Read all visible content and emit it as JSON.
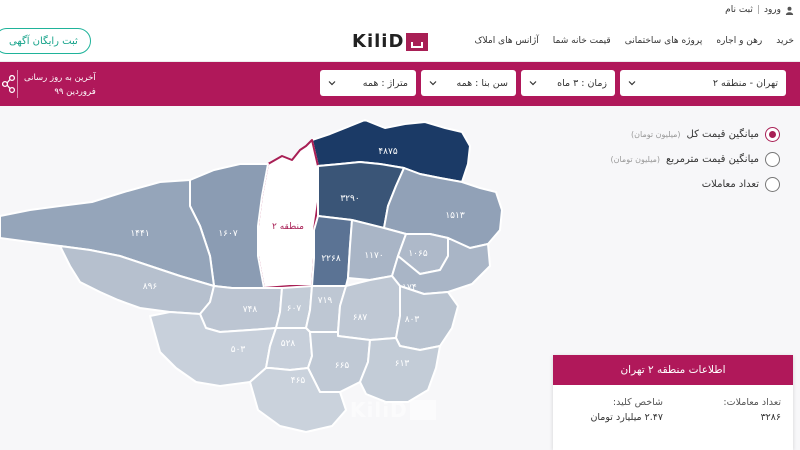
{
  "auth": {
    "login": "ورود",
    "separator": "|",
    "register": "ثبت نام"
  },
  "nav": {
    "links": [
      "خرید",
      "رهن و اجاره",
      "پروژه های ساختمانی",
      "قیمت خانه شما",
      "آژانس های املاک"
    ],
    "logo": "KiliD",
    "cta": "ثبت رایگان آگهی"
  },
  "filters": {
    "region": "تهران - منطقه ۲",
    "time": "زمان : ۳ ماه",
    "age": "سن بنا : همه",
    "area": "متراژ : همه"
  },
  "updated": {
    "line1": "آخرین به روز رسانی",
    "line2": "فروردین ۹۹"
  },
  "legend": {
    "options": [
      {
        "label": "میانگین قیمت کل",
        "unit": "(میلیون تومان)",
        "selected": true
      },
      {
        "label": "میانگین قیمت مترمربع",
        "unit": "(میلیون تومان)",
        "selected": false
      },
      {
        "label": "تعداد معاملات",
        "unit": "",
        "selected": false
      }
    ]
  },
  "map": {
    "regions": [
      {
        "name": "north-east",
        "value": "۴۸۷۵",
        "color": "#1b3a66"
      },
      {
        "name": "selected",
        "value": "منطقه ۲",
        "color": "#ffffff",
        "selected": true
      },
      {
        "name": "r3",
        "value": "۳۲۹۰",
        "color": "#3a5577"
      },
      {
        "name": "r2268",
        "value": "۲۲۶۸",
        "color": "#5b7394"
      },
      {
        "name": "r1607",
        "value": "۱۶۰۷",
        "color": "#8b9cb3"
      },
      {
        "name": "r1513",
        "value": "۱۵۱۳",
        "color": "#91a1b7"
      },
      {
        "name": "r1441",
        "value": "۱۴۴۱",
        "color": "#95a5ba"
      },
      {
        "name": "r1170",
        "value": "۱۱۷۰",
        "color": "#a9b5c6"
      },
      {
        "name": "r1174",
        "value": "۱۱۷۴",
        "color": "#a9b5c6"
      },
      {
        "name": "r1065",
        "value": "۱۰۶۵",
        "color": "#aeb9c9"
      },
      {
        "name": "r896",
        "value": "۸۹۶",
        "color": "#b6c0ce"
      },
      {
        "name": "r803",
        "value": "۸۰۳",
        "color": "#b9c3d0"
      },
      {
        "name": "r748",
        "value": "۷۴۸",
        "color": "#bcc5d2"
      },
      {
        "name": "r719",
        "value": "۷۱۹",
        "color": "#bec7d3"
      },
      {
        "name": "r687",
        "value": "۶۸۷",
        "color": "#bfc8d4"
      },
      {
        "name": "r665",
        "value": "۶۶۵",
        "color": "#c0c9d5"
      },
      {
        "name": "r613",
        "value": "۶۱۳",
        "color": "#c3ccd7"
      },
      {
        "name": "r607",
        "value": "۶۰۷",
        "color": "#c3ccd7"
      },
      {
        "name": "r528",
        "value": "۵۲۸",
        "color": "#c7cfda"
      },
      {
        "name": "r503",
        "value": "۵۰۳",
        "color": "#c8d0db"
      },
      {
        "name": "r465",
        "value": "۴۶۵",
        "color": "#cad2dc"
      }
    ]
  },
  "card": {
    "title": "اطلاعات منطقه ۲ تهران",
    "deals_label": "تعداد معاملات:",
    "deals_value": "۳۲۸۶",
    "index_label": "شاخص کلید:",
    "index_value": "۲.۴۷ میلیارد تومان"
  }
}
